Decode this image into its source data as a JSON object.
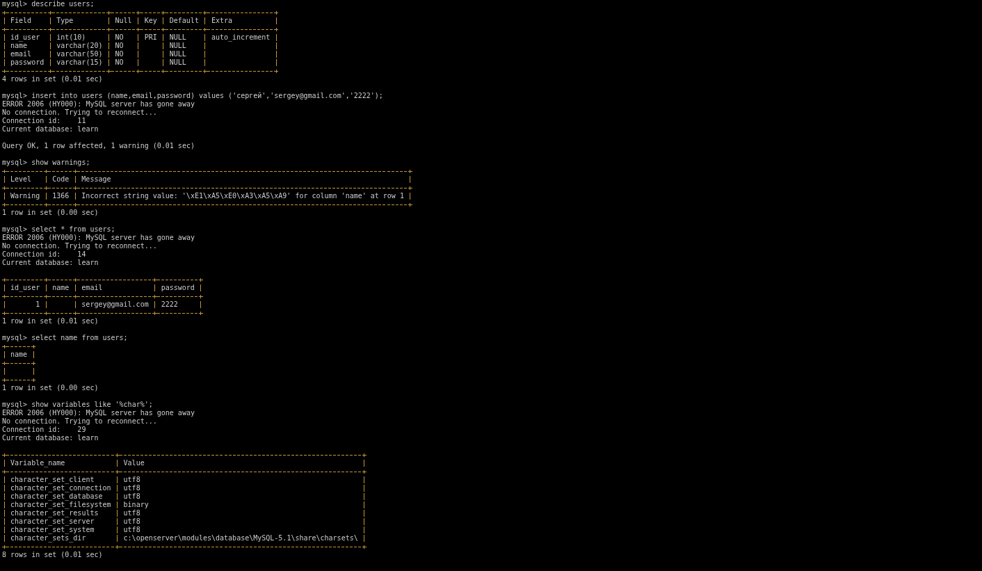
{
  "console": {
    "lines": [
      {
        "kind": "text",
        "text": "mysql> describe users;"
      },
      {
        "kind": "table",
        "columns": [
          {
            "label": "Field"
          },
          {
            "label": "Type"
          },
          {
            "label": "Null"
          },
          {
            "label": "Key"
          },
          {
            "label": "Default"
          },
          {
            "label": "Extra"
          }
        ],
        "rows": [
          [
            "id_user",
            "int(10)",
            "NO",
            "PRI",
            "NULL",
            "auto_increment"
          ],
          [
            "name",
            "varchar(20)",
            "NO",
            null,
            "NULL",
            null
          ],
          [
            "email",
            "varchar(50)",
            "NO",
            null,
            "NULL",
            null
          ],
          [
            "password",
            "varchar(15)",
            "NO",
            null,
            "NULL",
            null
          ]
        ]
      },
      {
        "kind": "text",
        "text": "4 rows in set (0.01 sec)"
      },
      {
        "kind": "blank"
      },
      {
        "kind": "text",
        "text": "mysql> insert into users (name,email,password) values ('сергей','sergey@gmail.com','2222');"
      },
      {
        "kind": "text",
        "text": "ERROR 2006 (HY000): MySQL server has gone away"
      },
      {
        "kind": "text",
        "text": "No connection. Trying to reconnect..."
      },
      {
        "kind": "text",
        "text": "Connection id:    11"
      },
      {
        "kind": "text",
        "text": "Current database: learn"
      },
      {
        "kind": "blank"
      },
      {
        "kind": "text",
        "text": "Query OK, 1 row affected, 1 warning (0.01 sec)"
      },
      {
        "kind": "blank"
      },
      {
        "kind": "text",
        "text": "mysql> show warnings;"
      },
      {
        "kind": "table",
        "columns": [
          {
            "label": "Level"
          },
          {
            "label": "Code"
          },
          {
            "label": "Message"
          }
        ],
        "rows": [
          [
            "Warning",
            "1366",
            "Incorrect string value: '\\xE1\\xA5\\xE0\\xA3\\xA5\\xA9' for column 'name' at row 1"
          ]
        ]
      },
      {
        "kind": "text",
        "text": "1 row in set (0.00 sec)"
      },
      {
        "kind": "blank"
      },
      {
        "kind": "text",
        "text": "mysql> select * from users;"
      },
      {
        "kind": "text",
        "text": "ERROR 2006 (HY000): MySQL server has gone away"
      },
      {
        "kind": "text",
        "text": "No connection. Trying to reconnect..."
      },
      {
        "kind": "text",
        "text": "Connection id:    14"
      },
      {
        "kind": "text",
        "text": "Current database: learn"
      },
      {
        "kind": "blank"
      },
      {
        "kind": "table",
        "columns": [
          {
            "label": "id_user",
            "right_aligned": true
          },
          {
            "label": "name"
          },
          {
            "label": "email"
          },
          {
            "label": "password"
          }
        ],
        "rows": [
          [
            "1",
            null,
            "sergey@gmail.com",
            "2222"
          ]
        ]
      },
      {
        "kind": "text",
        "text": "1 row in set (0.01 sec)"
      },
      {
        "kind": "blank"
      },
      {
        "kind": "text",
        "text": "mysql> select name from users;"
      },
      {
        "kind": "table",
        "columns": [
          {
            "label": "name"
          }
        ],
        "rows": [
          [
            null
          ]
        ]
      },
      {
        "kind": "text",
        "text": "1 row in set (0.00 sec)"
      },
      {
        "kind": "blank"
      },
      {
        "kind": "text",
        "text": "mysql> show variables like '%char%';"
      },
      {
        "kind": "text",
        "text": "ERROR 2006 (HY000): MySQL server has gone away"
      },
      {
        "kind": "text",
        "text": "No connection. Trying to reconnect..."
      },
      {
        "kind": "text",
        "text": "Connection id:    29"
      },
      {
        "kind": "text",
        "text": "Current database: learn"
      },
      {
        "kind": "blank"
      },
      {
        "kind": "table",
        "columns": [
          {
            "label": "Variable_name"
          },
          {
            "label": "Value"
          }
        ],
        "rows": [
          [
            "character_set_client",
            "utf8"
          ],
          [
            "character_set_connection",
            "utf8"
          ],
          [
            "character_set_database",
            "utf8"
          ],
          [
            "character_set_filesystem",
            "binary"
          ],
          [
            "character_set_results",
            "utf8"
          ],
          [
            "character_set_server",
            "utf8"
          ],
          [
            "character_set_system",
            "utf8"
          ],
          [
            "character_sets_dir",
            "c:\\openserver\\modules\\database\\MySQL-5.1\\share\\charsets\\"
          ]
        ]
      },
      {
        "kind": "text",
        "text": "8 rows in set (0.01 sec)"
      }
    ]
  }
}
